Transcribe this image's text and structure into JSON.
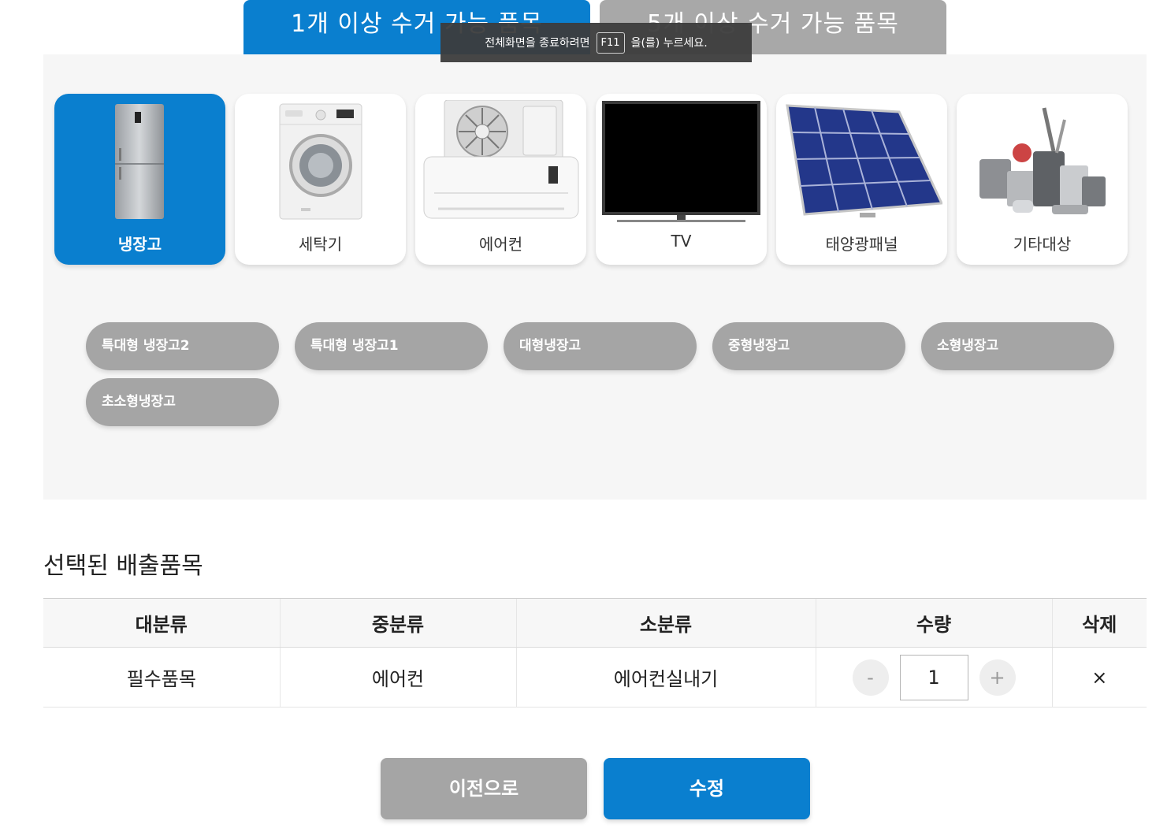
{
  "tabs": {
    "active_label": "1개 이상 수거 가능 품목",
    "inactive_label": "5개 이상 수거 가능 품목"
  },
  "toast": {
    "prefix": "전체화면을 종료하려면",
    "key": "F11",
    "suffix": "을(를) 누르세요."
  },
  "categories": [
    {
      "label": "냉장고",
      "icon": "refrigerator-icon",
      "selected": true
    },
    {
      "label": "세탁기",
      "icon": "washing-machine-icon",
      "selected": false
    },
    {
      "label": "에어컨",
      "icon": "air-conditioner-icon",
      "selected": false
    },
    {
      "label": "TV",
      "icon": "tv-icon",
      "selected": false
    },
    {
      "label": "태양광패널",
      "icon": "solar-panel-icon",
      "selected": false
    },
    {
      "label": "기타대상",
      "icon": "other-appliances-icon",
      "selected": false
    }
  ],
  "subcategories": [
    "특대형 냉장고2",
    "특대형 냉장고1",
    "대형냉장고",
    "중형냉장고",
    "소형냉장고",
    "초소형냉장고"
  ],
  "selected_section": {
    "title": "선택된 배출품목",
    "headers": [
      "대분류",
      "중분류",
      "소분류",
      "수량",
      "삭제"
    ],
    "rows": [
      {
        "major": "필수품목",
        "middle": "에어컨",
        "minor": "에어컨실내기",
        "qty": "1",
        "minus": "-",
        "plus": "+",
        "delete": "×"
      }
    ]
  },
  "actions": {
    "prev_label": "이전으로",
    "edit_label": "수정"
  },
  "colors": {
    "accent": "#0a7fcf",
    "inactive": "#a5a5a5",
    "panel_bg": "#f6f6f6"
  }
}
